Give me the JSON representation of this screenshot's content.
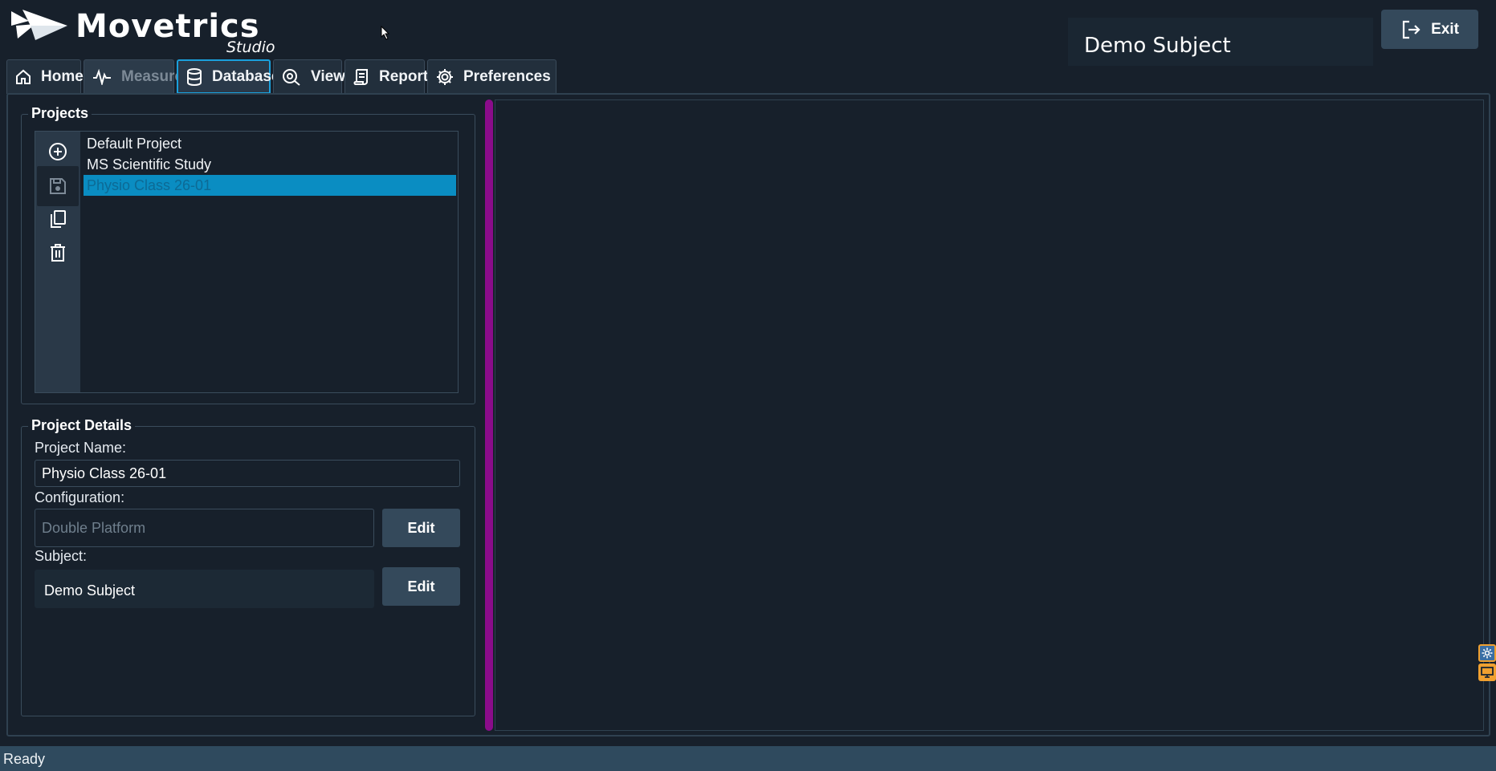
{
  "app": {
    "logo_text": "Movetrics",
    "logo_subtext": "Studio"
  },
  "header": {
    "subject_name": "Demo Subject",
    "exit_label": "Exit"
  },
  "tabs": [
    {
      "label": "Home",
      "icon": "home-icon",
      "state": "normal"
    },
    {
      "label": "Measure",
      "icon": "pulse-icon",
      "state": "disabled"
    },
    {
      "label": "Database",
      "icon": "database-icon",
      "state": "active"
    },
    {
      "label": "View",
      "icon": "eye-icon",
      "state": "normal"
    },
    {
      "label": "Report",
      "icon": "report-icon",
      "state": "normal"
    },
    {
      "label": "Preferences",
      "icon": "gear-icon",
      "state": "normal"
    }
  ],
  "projects": {
    "title": "Projects",
    "toolbar": [
      "add-icon",
      "save-icon",
      "copy-icon",
      "trash-icon"
    ],
    "items": [
      "Default Project",
      "MS Scientific Study",
      "Physio Class 26-01"
    ],
    "selected_index": 2
  },
  "details": {
    "title": "Project Details",
    "name_label": "Project Name:",
    "name_value": "Physio Class 26-01",
    "config_label": "Configuration:",
    "config_value": "Double Platform",
    "config_edit_label": "Edit",
    "subject_label": "Subject:",
    "subject_value": "Demo Subject",
    "subject_edit_label": "Edit"
  },
  "status": {
    "text": "Ready"
  },
  "colors": {
    "background": "#17202b",
    "button": "#34495b",
    "active_tab_border": "#1aa0dc",
    "selection": "#0a8dc2",
    "splitter": "#8a0c8a",
    "status_bar": "#2f4a5e"
  }
}
